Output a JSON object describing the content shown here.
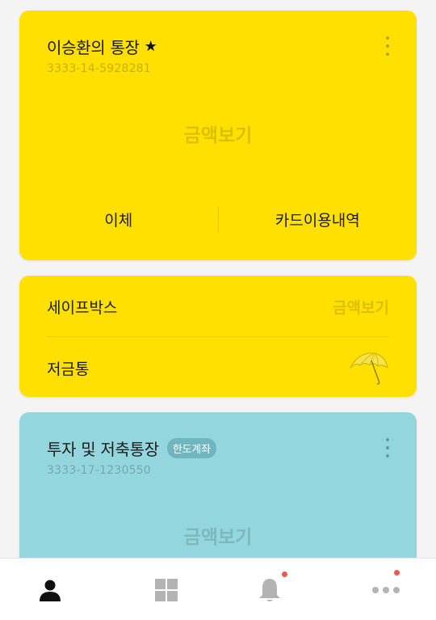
{
  "accounts": {
    "main": {
      "title": "이승환의 통장",
      "number": "3333-14-5928281",
      "amount_label": "금액보기",
      "actions": {
        "transfer": "이체",
        "card_history": "카드이용내역"
      },
      "color": "#ffe000"
    },
    "safebox": {
      "label": "세이프박스",
      "amount_label": "금액보기"
    },
    "piggybank": {
      "label": "저금통"
    },
    "invest": {
      "title": "투자 및 저축통장",
      "badge": "한도계좌",
      "number": "3333-17-1230550",
      "amount_label": "금액보기",
      "color": "#93d6de"
    }
  },
  "bottom_nav": {
    "items": [
      {
        "icon": "person-icon",
        "active": true
      },
      {
        "icon": "grid-icon",
        "active": false
      },
      {
        "icon": "bell-icon",
        "active": false,
        "has_badge": true
      },
      {
        "icon": "more-horizontal-icon",
        "active": false,
        "has_badge": true
      }
    ],
    "badge_color": "#f0574f"
  }
}
